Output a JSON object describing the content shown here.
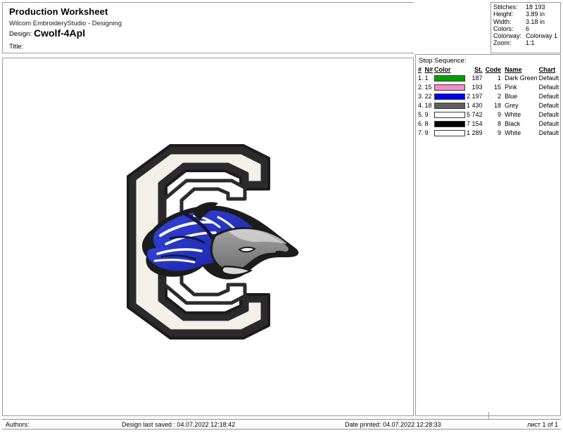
{
  "header": {
    "title": "Production Worksheet",
    "subtitle": "Wilcom EmbroideryStudio - Designing",
    "design_label": "Design:",
    "design_value": "Cwolf-4Apl",
    "title_label": "Title:",
    "title_value": ""
  },
  "stats": {
    "rows": [
      {
        "key": "Stitches:",
        "value": "18 193"
      },
      {
        "key": "Height:",
        "value": "3.89 in"
      },
      {
        "key": "Width:",
        "value": "3.18 in"
      },
      {
        "key": "Colors:",
        "value": "6"
      },
      {
        "key": "Colorway:",
        "value": "Colorway 1"
      },
      {
        "key": "Zoom:",
        "value": "1:1"
      }
    ]
  },
  "stop_sequence": {
    "title": "Stop Sequence:",
    "columns": {
      "idx": "#",
      "needle": "N#",
      "color": "Color",
      "stitches": "St.",
      "code": "Code",
      "name": "Name",
      "chart": "Chart"
    },
    "rows": [
      {
        "idx": "1.",
        "needle": "1",
        "color": "#00a000",
        "stitches": "187",
        "code": "1",
        "name": "Dark Green",
        "chart": "Default"
      },
      {
        "idx": "2.",
        "needle": "15",
        "color": "#f58cc8",
        "stitches": "193",
        "code": "15",
        "name": "Pink",
        "chart": "Default"
      },
      {
        "idx": "3.",
        "needle": "22",
        "color": "#0000f0",
        "stitches": "2 197",
        "code": "2",
        "name": "Blue",
        "chart": "Default"
      },
      {
        "idx": "4.",
        "needle": "18",
        "color": "#606060",
        "stitches": "1 430",
        "code": "18",
        "name": "Grey",
        "chart": "Default"
      },
      {
        "idx": "5.",
        "needle": "9",
        "color": "#ffffff",
        "stitches": "5 742",
        "code": "9",
        "name": "White",
        "chart": "Default"
      },
      {
        "idx": "6.",
        "needle": "8",
        "color": "#000000",
        "stitches": "7 154",
        "code": "8",
        "name": "Black",
        "chart": "Default"
      },
      {
        "idx": "7.",
        "needle": "9",
        "color": "#ffffff",
        "stitches": "1 289",
        "code": "9",
        "name": "White",
        "chart": "Default"
      }
    ]
  },
  "design": {
    "alt": "Embroidered block letter C with wolf head",
    "letter_outline_color": "#2b2b2b",
    "letter_fill_color": "#f2efe9",
    "wolf_blue": "#2233c4",
    "wolf_grey": "#8a8a8a"
  },
  "footer": {
    "authors": "Authors:",
    "last_saved": "Design last saved : 04.07.2022 12:18:42",
    "date_printed": "Date printed: 04.07.2022 12:28:33",
    "page": "лист 1 of 1"
  }
}
